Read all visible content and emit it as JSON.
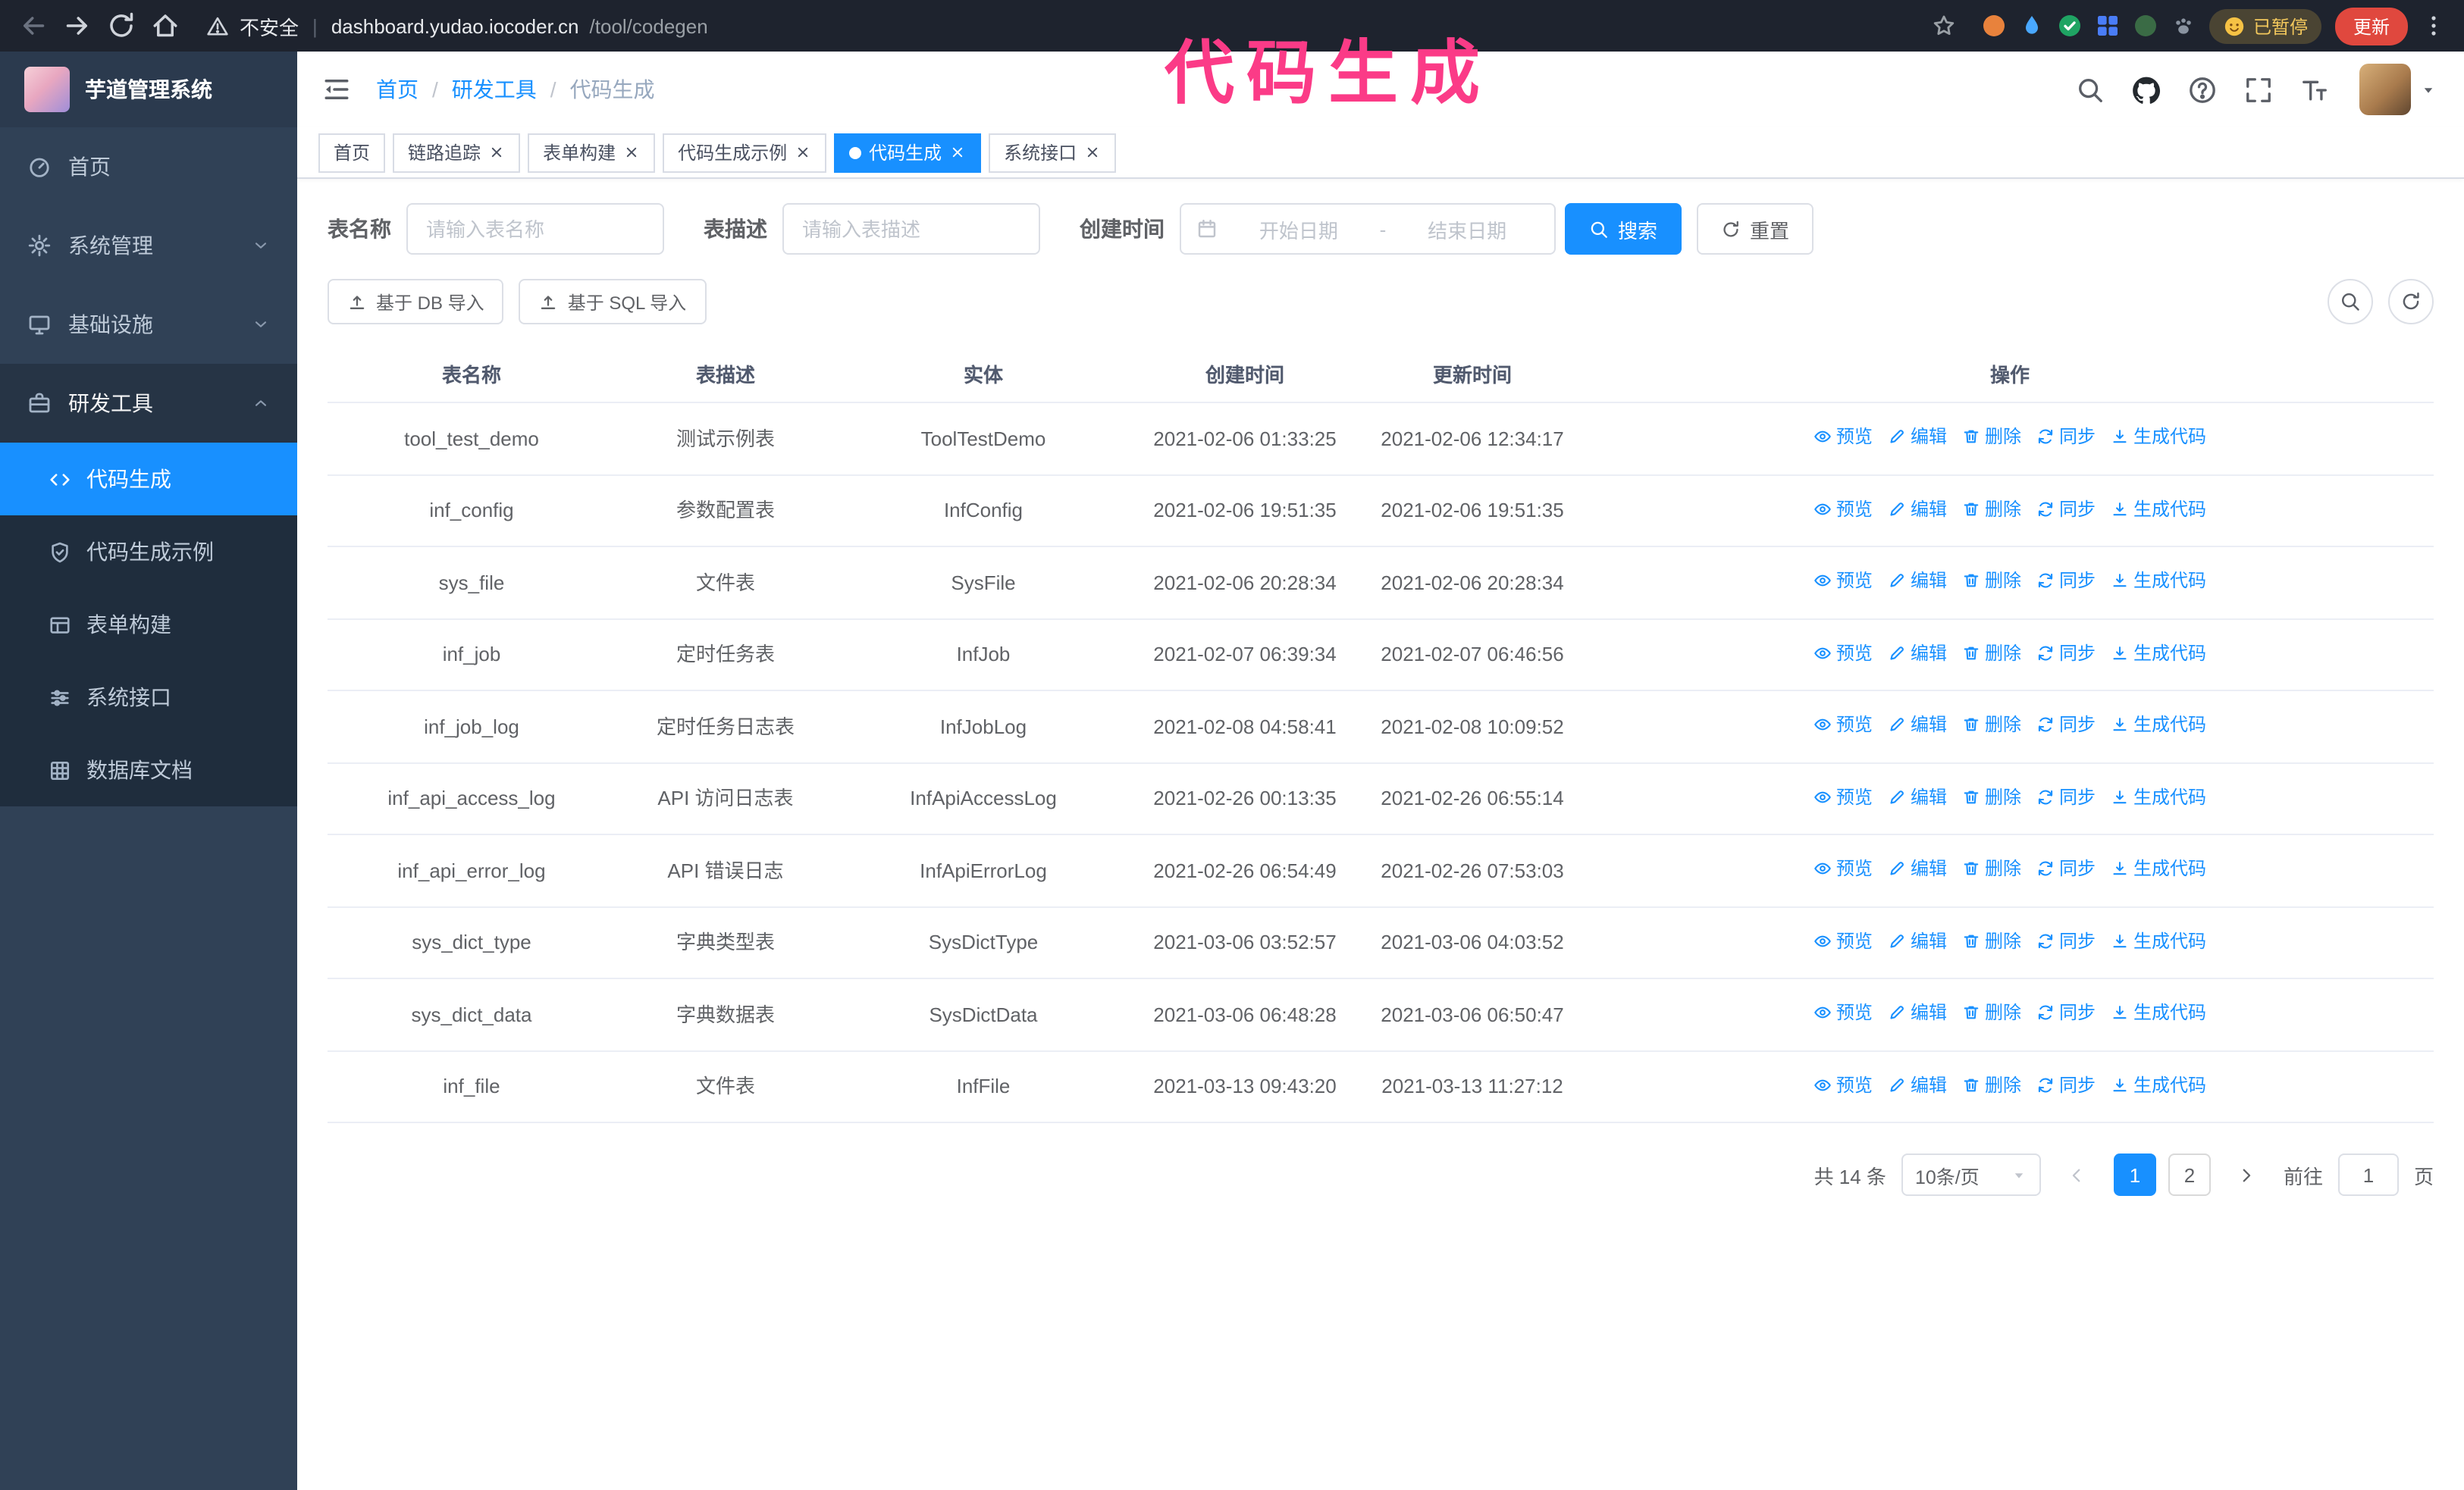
{
  "annotation": {
    "text": "代码生成"
  },
  "browser": {
    "nav_icons": [
      "back-icon",
      "forward-icon",
      "refresh-icon",
      "home-icon"
    ],
    "insecure_label": "不安全",
    "url_host": "dashboard.yudao.iocoder.cn",
    "url_path": "/tool/codegen",
    "extensions": [
      {
        "shape": "circle",
        "color": "#e8823c"
      },
      {
        "shape": "drop",
        "color": "#49a8ff"
      },
      {
        "shape": "check-circle",
        "color": "#1fa463"
      },
      {
        "shape": "grid",
        "color": "#4a7df7"
      },
      {
        "shape": "circle",
        "color": "#3a6b45"
      },
      {
        "shape": "paw",
        "color": "#8a93a0"
      }
    ],
    "paused_badge": "已暂停",
    "update_button": "更新"
  },
  "sidebar": {
    "app_title": "芋道管理系统",
    "items": [
      {
        "key": "home",
        "label": "首页",
        "icon": "dashboard-icon",
        "expandable": false,
        "expanded": false
      },
      {
        "key": "system",
        "label": "系统管理",
        "icon": "gear-icon",
        "expandable": true,
        "expanded": false
      },
      {
        "key": "infra",
        "label": "基础设施",
        "icon": "infra-icon",
        "expandable": true,
        "expanded": false
      },
      {
        "key": "devtools",
        "label": "研发工具",
        "icon": "tools-icon",
        "expandable": true,
        "expanded": true
      }
    ],
    "submenu": [
      {
        "key": "codegen",
        "label": "代码生成",
        "icon": "code-icon",
        "active": true
      },
      {
        "key": "codegen-example",
        "label": "代码生成示例",
        "icon": "shield-icon",
        "active": false
      },
      {
        "key": "form-builder",
        "label": "表单构建",
        "icon": "form-icon",
        "active": false
      },
      {
        "key": "api",
        "label": "系统接口",
        "icon": "sliders-icon",
        "active": false
      },
      {
        "key": "db-doc",
        "label": "数据库文档",
        "icon": "db-grid-icon",
        "active": false
      }
    ]
  },
  "header": {
    "breadcrumb": [
      "首页",
      "研发工具",
      "代码生成"
    ],
    "breadcrumb_separator": "/",
    "icons": [
      "search-icon",
      "github-icon",
      "question-icon",
      "fullscreen-icon",
      "font-size-icon"
    ]
  },
  "tabs": [
    {
      "label": "首页",
      "closable": false,
      "active": false
    },
    {
      "label": "链路追踪",
      "closable": true,
      "active": false
    },
    {
      "label": "表单构建",
      "closable": true,
      "active": false
    },
    {
      "label": "代码生成示例",
      "closable": true,
      "active": false
    },
    {
      "label": "代码生成",
      "closable": true,
      "active": true
    },
    {
      "label": "系统接口",
      "closable": true,
      "active": false
    }
  ],
  "filters": {
    "table_name_label": "表名称",
    "table_name_placeholder": "请输入表名称",
    "table_desc_label": "表描述",
    "table_desc_placeholder": "请输入表描述",
    "create_time_label": "创建时间",
    "date_start_placeholder": "开始日期",
    "date_separator": "-",
    "date_end_placeholder": "结束日期",
    "search_button": "搜索",
    "reset_button": "重置"
  },
  "toolbar": {
    "import_db_button": "基于 DB 导入",
    "import_sql_button": "基于 SQL 导入"
  },
  "table": {
    "columns": [
      "表名称",
      "表描述",
      "实体",
      "创建时间",
      "更新时间",
      "操作"
    ],
    "row_actions": [
      {
        "key": "preview",
        "label": "预览",
        "icon": "eye-icon"
      },
      {
        "key": "edit",
        "label": "编辑",
        "icon": "edit-icon"
      },
      {
        "key": "delete",
        "label": "删除",
        "icon": "delete-icon"
      },
      {
        "key": "sync",
        "label": "同步",
        "icon": "sync-icon"
      },
      {
        "key": "generate",
        "label": "生成代码",
        "icon": "download-icon"
      }
    ],
    "rows": [
      {
        "name": "tool_test_demo",
        "desc": "测试示例表",
        "entity": "ToolTestDemo",
        "created": "2021-02-06 01:33:25",
        "updated": "2021-02-06 12:34:17"
      },
      {
        "name": "inf_config",
        "desc": "参数配置表",
        "entity": "InfConfig",
        "created": "2021-02-06 19:51:35",
        "updated": "2021-02-06 19:51:35"
      },
      {
        "name": "sys_file",
        "desc": "文件表",
        "entity": "SysFile",
        "created": "2021-02-06 20:28:34",
        "updated": "2021-02-06 20:28:34"
      },
      {
        "name": "inf_job",
        "desc": "定时任务表",
        "entity": "InfJob",
        "created": "2021-02-07 06:39:34",
        "updated": "2021-02-07 06:46:56"
      },
      {
        "name": "inf_job_log",
        "desc": "定时任务日志表",
        "entity": "InfJobLog",
        "created": "2021-02-08 04:58:41",
        "updated": "2021-02-08 10:09:52"
      },
      {
        "name": "inf_api_access_log",
        "desc": "API 访问日志表",
        "entity": "InfApiAccessLog",
        "created": "2021-02-26 00:13:35",
        "updated": "2021-02-26 06:55:14"
      },
      {
        "name": "inf_api_error_log",
        "desc": "API 错误日志",
        "entity": "InfApiErrorLog",
        "created": "2021-02-26 06:54:49",
        "updated": "2021-02-26 07:53:03"
      },
      {
        "name": "sys_dict_type",
        "desc": "字典类型表",
        "entity": "SysDictType",
        "created": "2021-03-06 03:52:57",
        "updated": "2021-03-06 04:03:52"
      },
      {
        "name": "sys_dict_data",
        "desc": "字典数据表",
        "entity": "SysDictData",
        "created": "2021-03-06 06:48:28",
        "updated": "2021-03-06 06:50:47"
      },
      {
        "name": "inf_file",
        "desc": "文件表",
        "entity": "InfFile",
        "created": "2021-03-13 09:43:20",
        "updated": "2021-03-13 11:27:12"
      }
    ]
  },
  "pagination": {
    "total_text": "共 14 条",
    "page_size": "10条/页",
    "pages": [
      "1",
      "2"
    ],
    "active_page": "1",
    "goto_label": "前往",
    "goto_value": "1",
    "goto_suffix": "页"
  },
  "colors": {
    "primary": "#1890ff",
    "sidebar_bg": "#304156",
    "submenu_bg": "#1f2d3d",
    "menu_active_bg": "#1890ff",
    "annotation": "#fb3b87",
    "update_button": "#e0483e",
    "chrome_bg": "#1e232e"
  }
}
